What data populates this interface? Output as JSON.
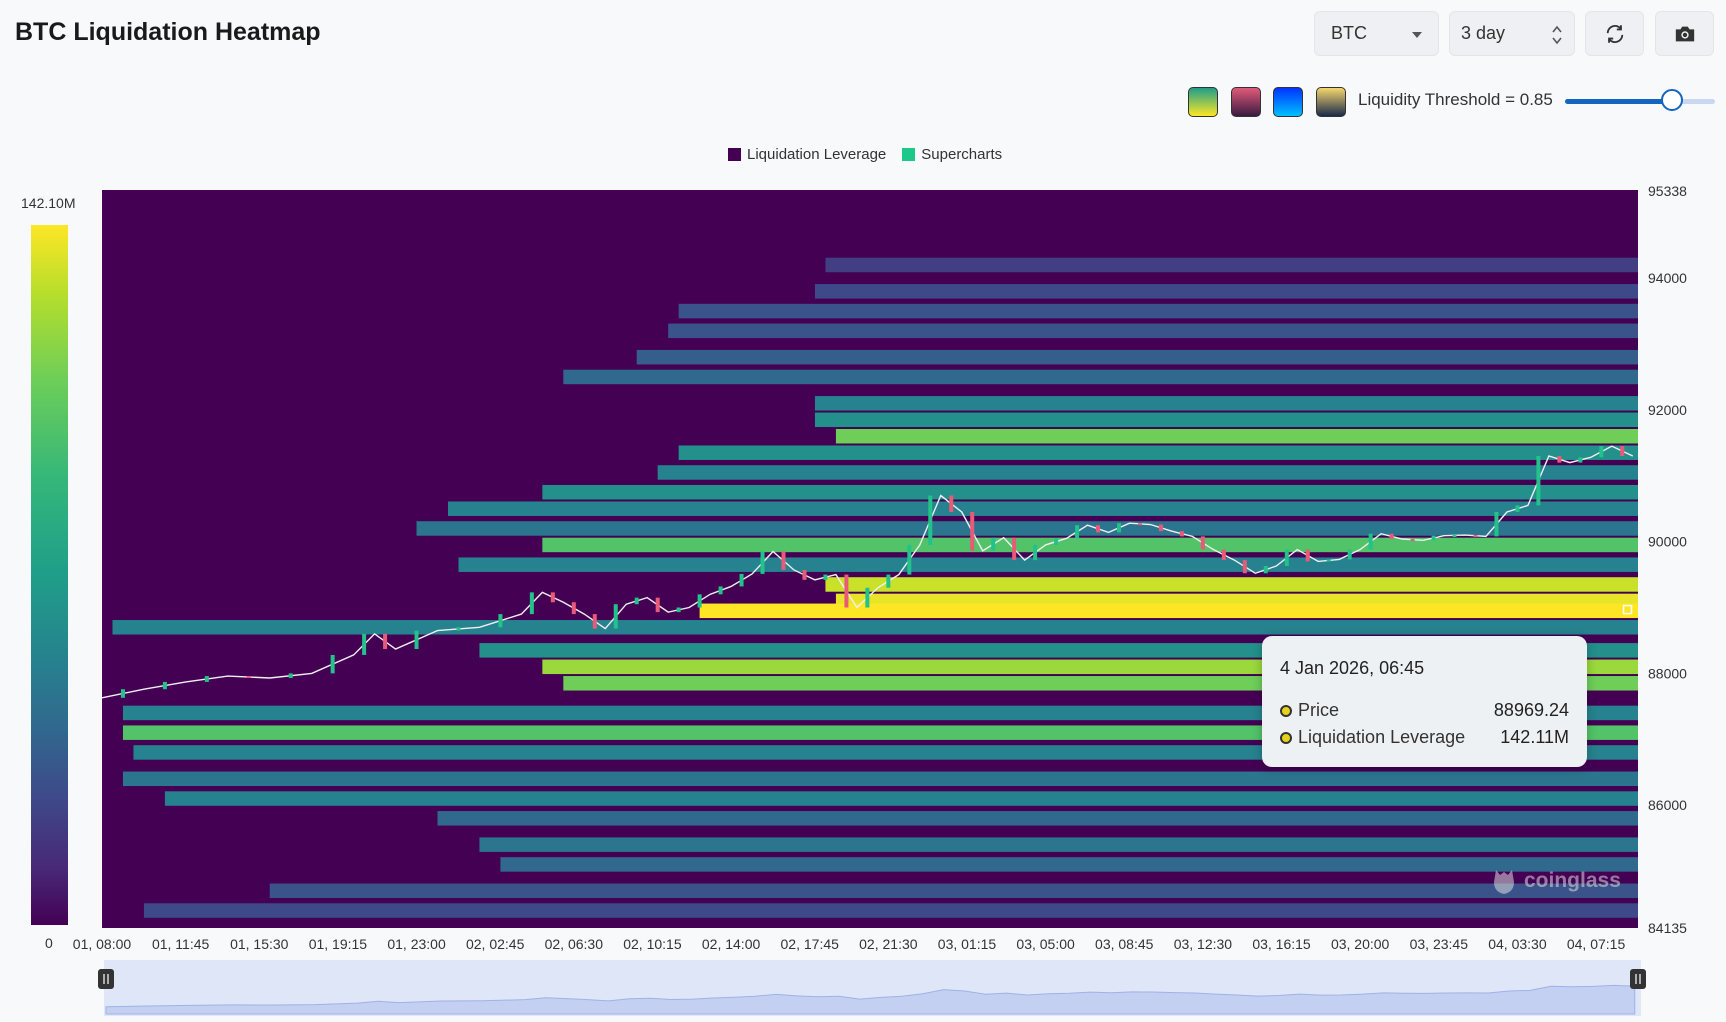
{
  "header": {
    "title": "BTC Liquidation Heatmap",
    "symbol": "BTC",
    "range": "3 day"
  },
  "palettes": [
    {
      "name": "viridis",
      "from": "#1f9e89",
      "to": "#fde725"
    },
    {
      "name": "rose",
      "from": "#e05a7a",
      "to": "#3a1a40"
    },
    {
      "name": "blue",
      "from": "#0033ff",
      "to": "#00c0ff"
    },
    {
      "name": "gold",
      "from": "#f5d76e",
      "to": "#1b2a4a"
    }
  ],
  "threshold": {
    "label": "Liquidity Threshold = 0.85",
    "value": 0.85,
    "min": 0,
    "max": 1
  },
  "legend": [
    {
      "label": "Liquidation Leverage",
      "color": "#440154"
    },
    {
      "label": "Supercharts",
      "color": "#1cc88a"
    }
  ],
  "colorbar": {
    "max_label": "142.10M",
    "min_label": "0"
  },
  "tooltip": {
    "title": "4 Jan 2026, 06:45",
    "price_label": "Price",
    "price_value": "88969.24",
    "lev_label": "Liquidation Leverage",
    "lev_value": "142.11M"
  },
  "watermark": "coinglass",
  "chart_data": {
    "type": "heatmap",
    "title": "BTC Liquidation Heatmap",
    "x_tick_labels": [
      "01, 08:00",
      "01, 11:45",
      "01, 15:30",
      "01, 19:15",
      "01, 23:00",
      "02, 02:45",
      "02, 06:30",
      "02, 10:15",
      "02, 14:00",
      "02, 17:45",
      "02, 21:30",
      "03, 01:15",
      "03, 05:00",
      "03, 08:45",
      "03, 12:30",
      "03, 16:15",
      "03, 20:00",
      "03, 23:45",
      "04, 03:30",
      "04, 07:15"
    ],
    "y_tick_labels": [
      "95338",
      "94000",
      "92000",
      "90000",
      "88000",
      "86000",
      "84135"
    ],
    "y_range": [
      84135,
      95338
    ],
    "x_range_hours": [
      0,
      73.25
    ],
    "colorscale_max": 142.1,
    "price_series": {
      "name": "Supercharts",
      "points": [
        [
          0,
          87630
        ],
        [
          2,
          87760
        ],
        [
          4,
          87870
        ],
        [
          6,
          87960
        ],
        [
          8,
          87930
        ],
        [
          10,
          88000
        ],
        [
          12,
          88280
        ],
        [
          13,
          88600
        ],
        [
          14,
          88370
        ],
        [
          16,
          88650
        ],
        [
          18,
          88700
        ],
        [
          20,
          88900
        ],
        [
          21,
          89230
        ],
        [
          22,
          89080
        ],
        [
          23,
          88900
        ],
        [
          24,
          88680
        ],
        [
          25,
          89050
        ],
        [
          26,
          89150
        ],
        [
          27,
          88930
        ],
        [
          28,
          89000
        ],
        [
          29,
          89200
        ],
        [
          30,
          89320
        ],
        [
          31,
          89510
        ],
        [
          32,
          89850
        ],
        [
          33,
          89570
        ],
        [
          34,
          89420
        ],
        [
          35,
          89500
        ],
        [
          36,
          89000
        ],
        [
          37,
          89300
        ],
        [
          38,
          89500
        ],
        [
          39,
          89950
        ],
        [
          40,
          90700
        ],
        [
          41,
          90450
        ],
        [
          42,
          89860
        ],
        [
          43,
          90060
        ],
        [
          44,
          89720
        ],
        [
          45,
          89950
        ],
        [
          46,
          90050
        ],
        [
          47,
          90250
        ],
        [
          48,
          90140
        ],
        [
          49,
          90280
        ],
        [
          50,
          90260
        ],
        [
          51,
          90160
        ],
        [
          52,
          90080
        ],
        [
          53,
          89880
        ],
        [
          54,
          89720
        ],
        [
          55,
          89520
        ],
        [
          56,
          89630
        ],
        [
          57,
          89880
        ],
        [
          58,
          89700
        ],
        [
          59,
          89730
        ],
        [
          60,
          89880
        ],
        [
          61,
          90120
        ],
        [
          62,
          90040
        ],
        [
          63,
          90020
        ],
        [
          64,
          90090
        ],
        [
          65,
          90100
        ],
        [
          66,
          90080
        ],
        [
          67,
          90450
        ],
        [
          68,
          90550
        ],
        [
          69,
          91300
        ],
        [
          70,
          91200
        ],
        [
          71,
          91280
        ],
        [
          72,
          91450
        ],
        [
          73,
          91300
        ]
      ]
    },
    "liquidation_bands": [
      {
        "price": 94200,
        "start_h": 34.5,
        "level": 0.25
      },
      {
        "price": 93800,
        "start_h": 34.0,
        "level": 0.3
      },
      {
        "price": 93500,
        "start_h": 27.5,
        "level": 0.35
      },
      {
        "price": 93200,
        "start_h": 27.0,
        "level": 0.35
      },
      {
        "price": 92800,
        "start_h": 25.5,
        "level": 0.4
      },
      {
        "price": 92500,
        "start_h": 22.0,
        "level": 0.45
      },
      {
        "price": 92100,
        "start_h": 34.0,
        "level": 0.55
      },
      {
        "price": 91850,
        "start_h": 34.0,
        "level": 0.6
      },
      {
        "price": 91600,
        "start_h": 35.0,
        "level": 0.85
      },
      {
        "price": 91350,
        "start_h": 27.5,
        "level": 0.6
      },
      {
        "price": 91050,
        "start_h": 26.5,
        "level": 0.55
      },
      {
        "price": 90750,
        "start_h": 21.0,
        "level": 0.6
      },
      {
        "price": 90500,
        "start_h": 16.5,
        "level": 0.55
      },
      {
        "price": 90200,
        "start_h": 15.0,
        "level": 0.5
      },
      {
        "price": 89950,
        "start_h": 21.0,
        "level": 0.8
      },
      {
        "price": 89650,
        "start_h": 17.0,
        "level": 0.55
      },
      {
        "price": 89350,
        "start_h": 34.5,
        "level": 0.95
      },
      {
        "price": 89100,
        "start_h": 35.0,
        "level": 0.98
      },
      {
        "price": 88950,
        "start_h": 28.5,
        "level": 1.0
      },
      {
        "price": 88700,
        "start_h": 0.5,
        "level": 0.55
      },
      {
        "price": 88350,
        "start_h": 18.0,
        "level": 0.6
      },
      {
        "price": 88100,
        "start_h": 21.0,
        "level": 0.9
      },
      {
        "price": 87850,
        "start_h": 22.0,
        "level": 0.85
      },
      {
        "price": 87400,
        "start_h": 1.0,
        "level": 0.55
      },
      {
        "price": 87100,
        "start_h": 1.0,
        "level": 0.8
      },
      {
        "price": 86800,
        "start_h": 1.5,
        "level": 0.55
      },
      {
        "price": 86400,
        "start_h": 1.0,
        "level": 0.5
      },
      {
        "price": 86100,
        "start_h": 3.0,
        "level": 0.55
      },
      {
        "price": 85800,
        "start_h": 16.0,
        "level": 0.45
      },
      {
        "price": 85400,
        "start_h": 18.0,
        "level": 0.5
      },
      {
        "price": 85100,
        "start_h": 19.0,
        "level": 0.45
      },
      {
        "price": 84700,
        "start_h": 8.0,
        "level": 0.35
      },
      {
        "price": 84400,
        "start_h": 2.0,
        "level": 0.3
      }
    ]
  }
}
